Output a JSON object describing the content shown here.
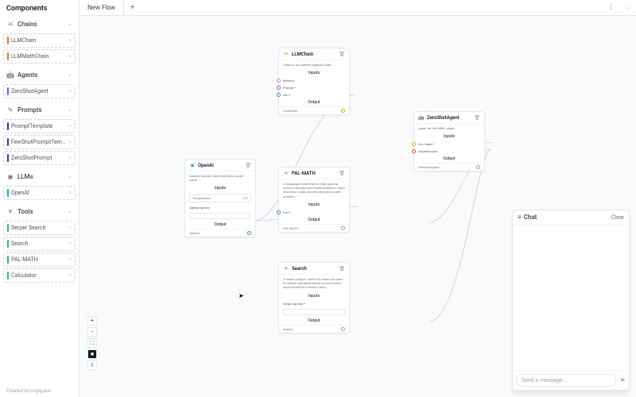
{
  "sidebar": {
    "title": "Components",
    "sections": [
      {
        "id": "chains",
        "label": "Chains",
        "icon": "link",
        "items": [
          {
            "label": "LLMChain",
            "color": "#f97316"
          },
          {
            "label": "LLMMathChain",
            "color": "#f97316"
          }
        ]
      },
      {
        "id": "agents",
        "label": "Agents",
        "icon": "robot",
        "items": [
          {
            "label": "ZeroShotAgent",
            "color": "#6366f1"
          }
        ]
      },
      {
        "id": "prompts",
        "label": "Prompts",
        "icon": "prompt",
        "items": [
          {
            "label": "PromptTemplate",
            "color": "#5b21b6"
          },
          {
            "label": "FewShotPromptTempla...",
            "color": "#5b21b6"
          },
          {
            "label": "ZeroShotPrompt",
            "color": "#5b21b6"
          }
        ]
      },
      {
        "id": "llms",
        "label": "LLMs",
        "icon": "brain",
        "items": [
          {
            "label": "OpenAI",
            "color": "#0ea5e9"
          }
        ]
      },
      {
        "id": "tools",
        "label": "Tools",
        "icon": "wrench",
        "items": [
          {
            "label": "Serper Search",
            "color": "#22c55e"
          },
          {
            "label": "Search",
            "color": "#22c55e"
          },
          {
            "label": "PAL-MATH",
            "color": "#22c55e"
          },
          {
            "label": "Calculator",
            "color": "#22c55e"
          }
        ]
      }
    ],
    "footer": "Created by Logspace"
  },
  "topbar": {
    "tab": "New Flow",
    "add": "+"
  },
  "nodes": {
    "openai": {
      "title": "OpenAI",
      "desc": "Generic OpenAI class that uses model name.",
      "inputs_label": "Inputs",
      "temperature_label": "Temperature",
      "temperature_value": "0.7",
      "apikey_label": "Openai api key",
      "output_label": "Output",
      "footer": "OpenAI"
    },
    "llmchain": {
      "title": "LLMChain",
      "desc": "Chain to run queries against LLMs.",
      "inputs_label": "Inputs",
      "memory": "Memory",
      "prompt": "Prompt *",
      "llm": "Llm *",
      "output_label": "Output",
      "footer": "LLMChain"
    },
    "palmath": {
      "title": "PAL-MATH",
      "desc": "A language model that is really good at solving complex word math problems. Input should be a fully worded hard word math problem.",
      "inputs_label": "Inputs",
      "llm": "Llm *",
      "output_label": "Output",
      "footer": "PAL-MATH"
    },
    "search": {
      "title": "Search",
      "desc": "A search engine. Useful for when you need to answer questions about current events. Input should be a search query.",
      "inputs_label": "Inputs",
      "apikey": "Serper api key *",
      "output_label": "Output",
      "footer": "Search"
    },
    "agent": {
      "title": "ZeroShotAgent",
      "desc": "Agent for the MRKL chain.",
      "inputs_label": "Inputs",
      "llmchain": "Llm chain *",
      "tools": "Allowed tools",
      "output_label": "Output",
      "footer": "ZeroShotAgent"
    }
  },
  "chat": {
    "title": "Chat",
    "clear": "Clear",
    "placeholder": "Send a message..."
  },
  "controls": {
    "zoom_in": "+",
    "zoom_out": "−",
    "fit": "⛶",
    "lock": "■",
    "export": "⇩"
  }
}
